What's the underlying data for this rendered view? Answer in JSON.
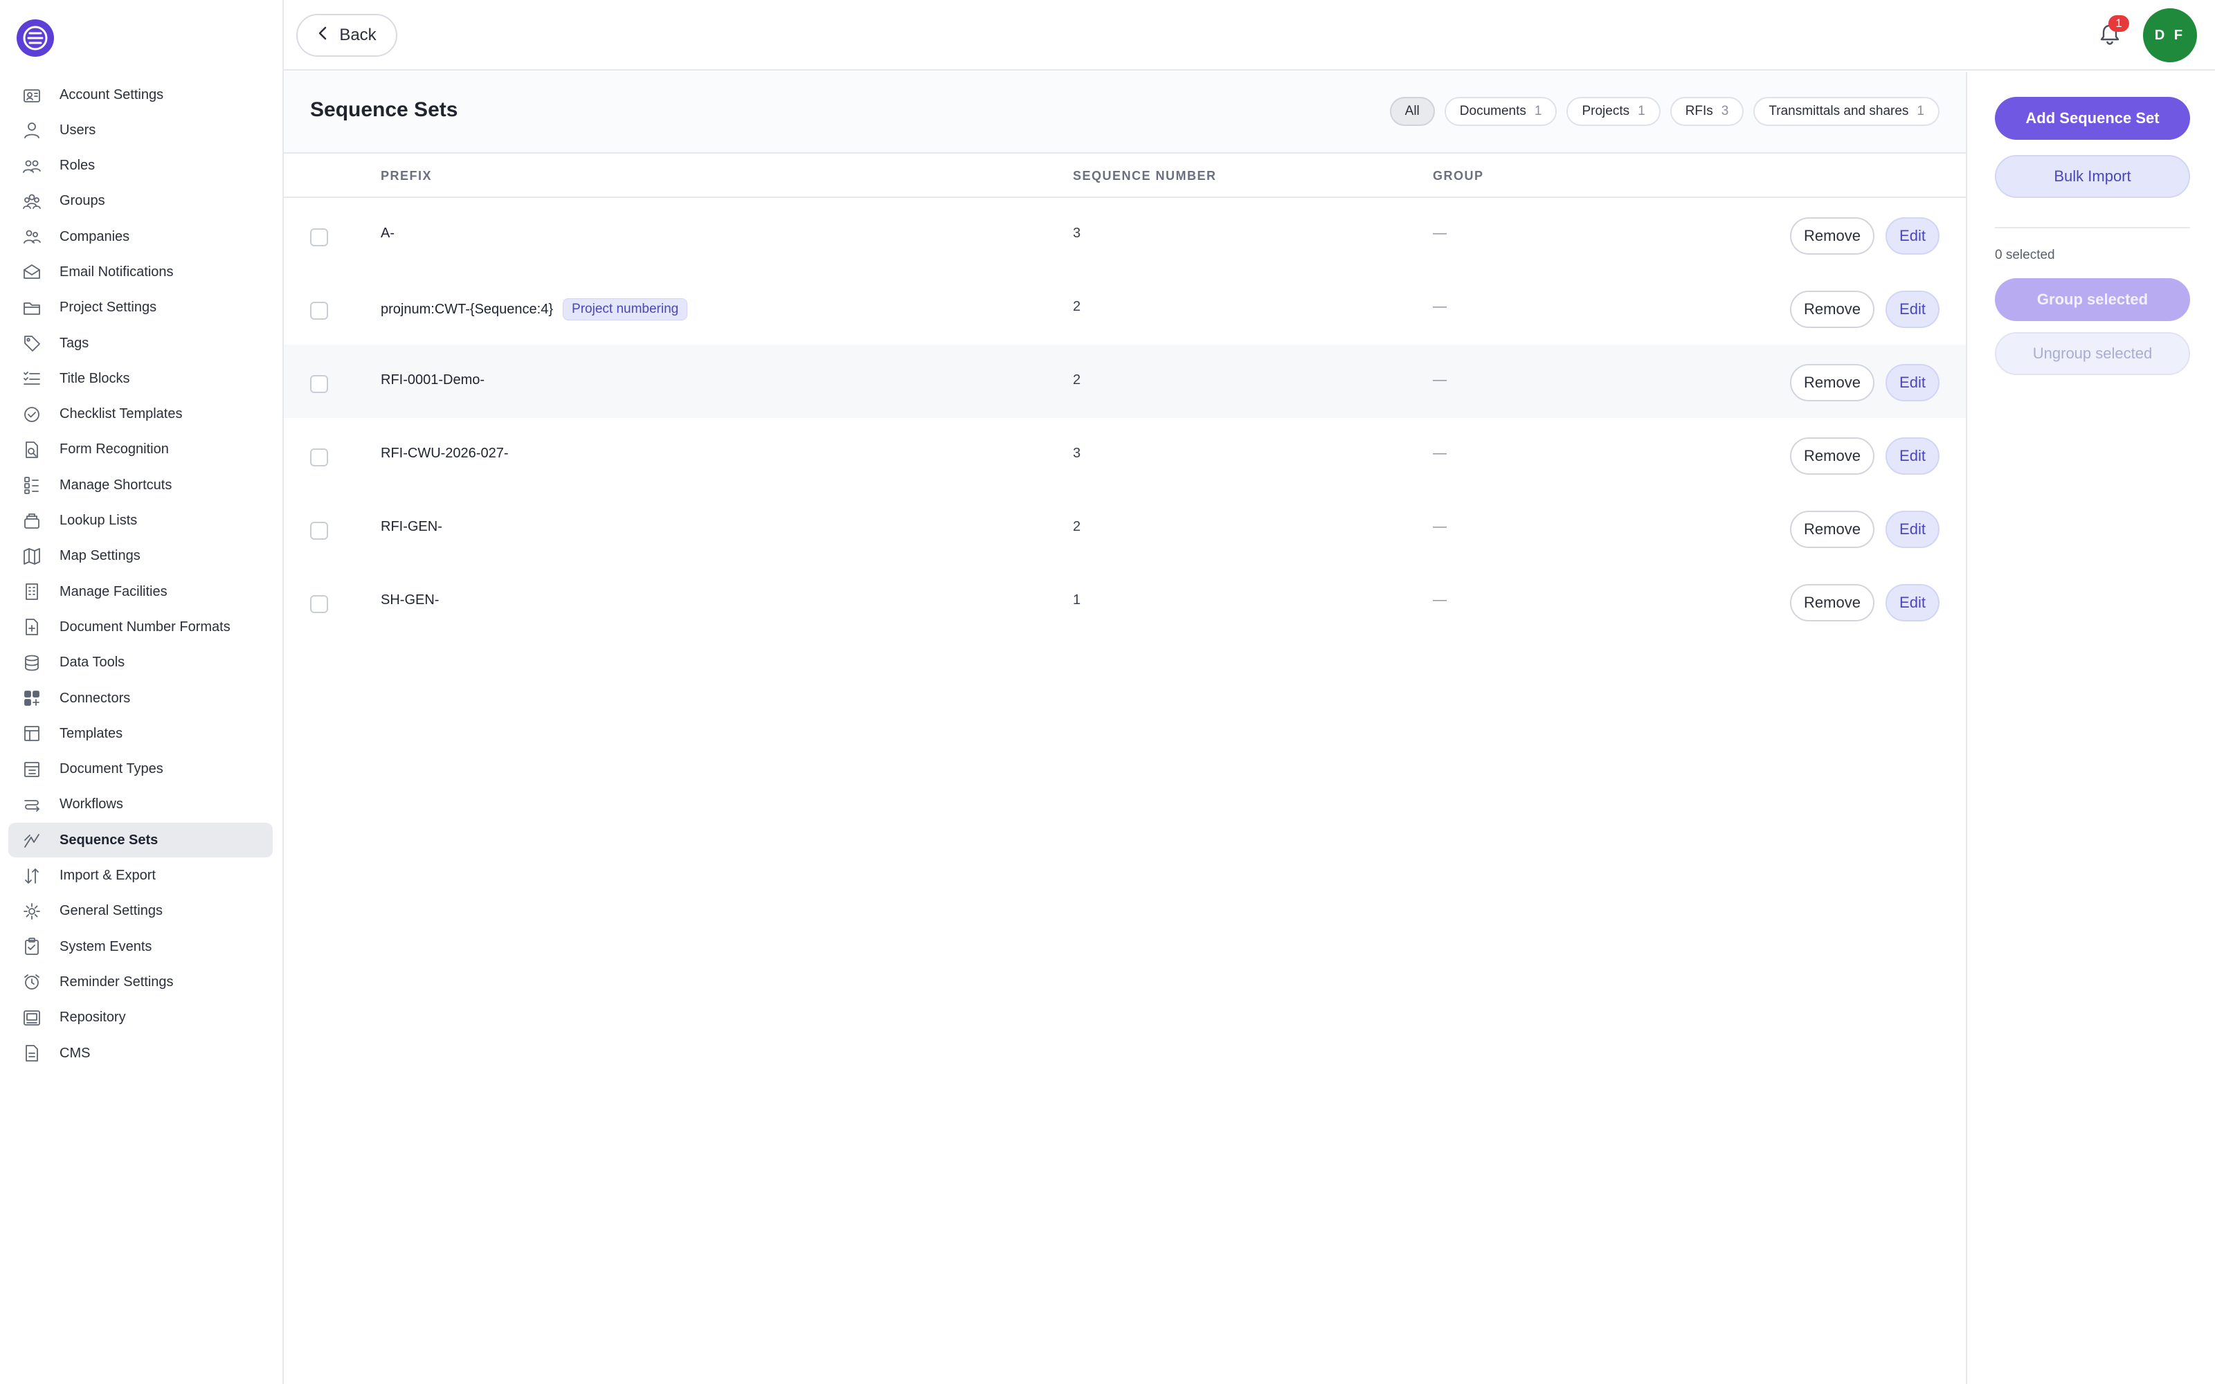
{
  "sidebar": {
    "items": [
      {
        "label": "Account Settings",
        "icon": "account-settings-icon"
      },
      {
        "label": "Users",
        "icon": "user-icon"
      },
      {
        "label": "Roles",
        "icon": "roles-icon"
      },
      {
        "label": "Groups",
        "icon": "groups-icon"
      },
      {
        "label": "Companies",
        "icon": "companies-icon"
      },
      {
        "label": "Email Notifications",
        "icon": "email-icon"
      },
      {
        "label": "Project Settings",
        "icon": "folder-icon"
      },
      {
        "label": "Tags",
        "icon": "tag-icon"
      },
      {
        "label": "Title Blocks",
        "icon": "checklist-lines-icon"
      },
      {
        "label": "Checklist Templates",
        "icon": "check-circle-icon"
      },
      {
        "label": "Form Recognition",
        "icon": "form-search-icon"
      },
      {
        "label": "Manage Shortcuts",
        "icon": "shortcuts-icon"
      },
      {
        "label": "Lookup Lists",
        "icon": "lookup-icon"
      },
      {
        "label": "Map Settings",
        "icon": "map-icon"
      },
      {
        "label": "Manage Facilities",
        "icon": "building-icon"
      },
      {
        "label": "Document Number Formats",
        "icon": "document-plus-icon"
      },
      {
        "label": "Data Tools",
        "icon": "database-icon"
      },
      {
        "label": "Connectors",
        "icon": "connectors-icon"
      },
      {
        "label": "Templates",
        "icon": "template-icon"
      },
      {
        "label": "Document Types",
        "icon": "document-types-icon"
      },
      {
        "label": "Workflows",
        "icon": "workflow-icon"
      },
      {
        "label": "Sequence Sets",
        "icon": "sequence-icon"
      },
      {
        "label": "Import & Export",
        "icon": "import-export-icon"
      },
      {
        "label": "General Settings",
        "icon": "gear-icon"
      },
      {
        "label": "System Events",
        "icon": "clipboard-check-icon"
      },
      {
        "label": "Reminder Settings",
        "icon": "alarm-icon"
      },
      {
        "label": "Repository",
        "icon": "repository-icon"
      },
      {
        "label": "CMS",
        "icon": "document-icon"
      }
    ],
    "active": "Sequence Sets"
  },
  "header": {
    "back_label": "Back",
    "notification_count": "1",
    "avatar_initials": "D F",
    "avatar_color": "#1f8a3c"
  },
  "main": {
    "title": "Sequence Sets",
    "filters": [
      {
        "label": "All",
        "count": ""
      },
      {
        "label": "Documents",
        "count": "1"
      },
      {
        "label": "Projects",
        "count": "1"
      },
      {
        "label": "RFIs",
        "count": "3"
      },
      {
        "label": "Transmittals and shares",
        "count": "1"
      }
    ],
    "columns": {
      "prefix": "PREFIX",
      "sequence_number": "SEQUENCE NUMBER",
      "group": "GROUP"
    },
    "rows": [
      {
        "prefix": "A-",
        "tag": "",
        "sequence": "3",
        "group": "—"
      },
      {
        "prefix": "projnum:CWT-{Sequence:4}",
        "tag": "Project numbering",
        "sequence": "2",
        "group": "—"
      },
      {
        "prefix": "RFI-0001-Demo-",
        "tag": "",
        "sequence": "2",
        "group": "—"
      },
      {
        "prefix": "RFI-CWU-2026-027-",
        "tag": "",
        "sequence": "3",
        "group": "—"
      },
      {
        "prefix": "RFI-GEN-",
        "tag": "",
        "sequence": "2",
        "group": "—"
      },
      {
        "prefix": "SH-GEN-",
        "tag": "",
        "sequence": "1",
        "group": "—"
      }
    ],
    "remove_label": "Remove",
    "edit_label": "Edit"
  },
  "panel": {
    "add_label": "Add Sequence Set",
    "bulk_label": "Bulk Import",
    "selected_text": "0 selected",
    "group_label": "Group selected",
    "ungroup_label": "Ungroup selected"
  },
  "colors": {
    "accent": "#7158e2",
    "brand": "#5b3fd6",
    "badge": "#e5393c"
  }
}
